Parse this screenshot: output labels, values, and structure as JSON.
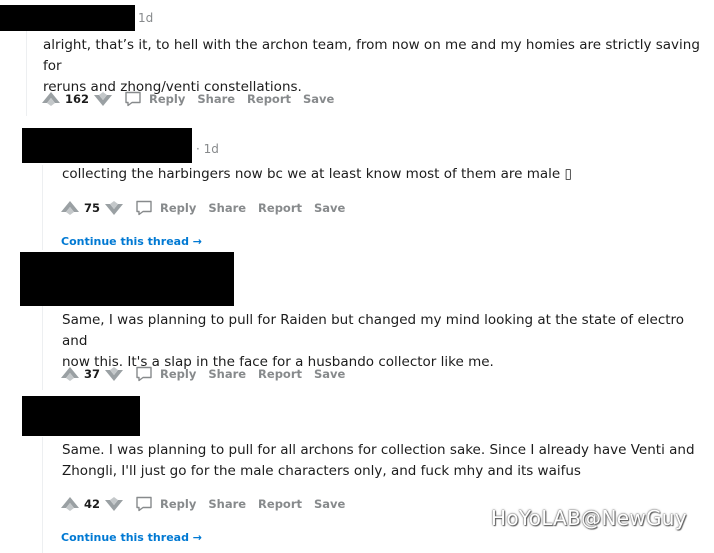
{
  "comments": [
    {
      "timestamp": "1d",
      "body_lines": [
        "alright, that’s it, to hell with the archon team, from now on me and my homies are strictly saving for",
        "reruns and zhong/venti constellations."
      ],
      "score": "162"
    },
    {
      "timestamp": "· 1d",
      "body_lines": [
        "collecting the harbingers now bc we at least know most of them are male ▯"
      ],
      "score": "75"
    },
    {
      "body_lines": [
        "Same, I was planning to pull for Raiden but changed my mind looking at the state of electro and",
        "now this. It's a slap in the face for a husbando collector like me."
      ],
      "score": "37"
    },
    {
      "body_lines": [
        "Same. I was planning to pull for all archons for collection sake. Since I already have Venti and",
        "Zhongli, I'll just go for the male characters only, and fuck mhy and its waifus"
      ],
      "score": "42"
    }
  ],
  "actions": {
    "reply": "Reply",
    "share": "Share",
    "report": "Report",
    "save": "Save"
  },
  "continue_thread": "Continue this thread",
  "continue_arrow": "→",
  "watermark": "HoYoLAB@NewGuy",
  "colors": {
    "meta": "#878a8c",
    "link": "#0079d3",
    "text": "#1c1c1c"
  },
  "icons": [
    "upvote-icon",
    "downvote-icon",
    "comment-icon",
    "arrow-right-icon"
  ]
}
